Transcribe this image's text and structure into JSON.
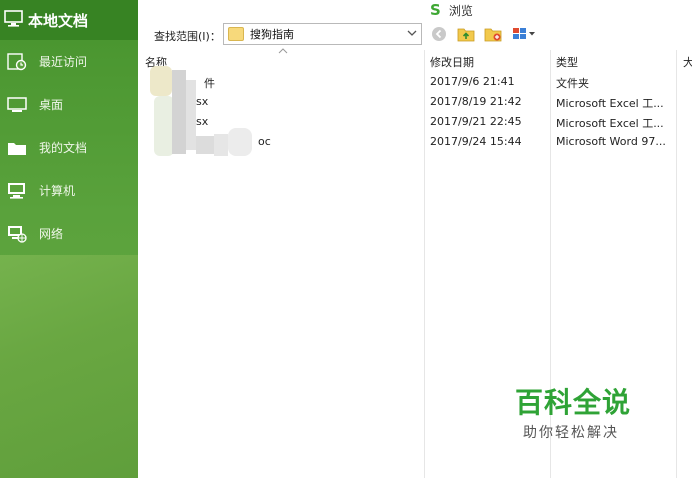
{
  "sidebar": {
    "title": "本地文档",
    "items": [
      {
        "label": "最近访问",
        "icon": "recent-icon"
      },
      {
        "label": "桌面",
        "icon": "desktop-icon"
      },
      {
        "label": "我的文档",
        "icon": "folder-icon"
      },
      {
        "label": "计算机",
        "icon": "computer-icon"
      },
      {
        "label": "网络",
        "icon": "network-icon"
      }
    ]
  },
  "toolbar": {
    "browse_logo": "S",
    "browse_label": "浏览",
    "range_label": "查找范围(I)：",
    "range_value": "搜狗指南"
  },
  "columns": {
    "name": "名称",
    "modified": "修改日期",
    "type": "类型",
    "size": "大"
  },
  "files": [
    {
      "name": "件",
      "modified": "2017/9/6 21:41",
      "type": "文件夹"
    },
    {
      "name": "sx",
      "modified": "2017/8/19 21:42",
      "type": "Microsoft Excel 工..."
    },
    {
      "name": "sx",
      "modified": "2017/9/21 22:45",
      "type": "Microsoft Excel 工..."
    },
    {
      "name": "oc",
      "modified": "2017/9/24 15:44",
      "type": "Microsoft Word 97..."
    }
  ],
  "watermark": {
    "title": "百科全说",
    "subtitle": "助你轻松解决"
  },
  "colors": {
    "sidebar_green": "#5aa23c",
    "header_green": "#378323",
    "brand_green": "#2fa336"
  }
}
